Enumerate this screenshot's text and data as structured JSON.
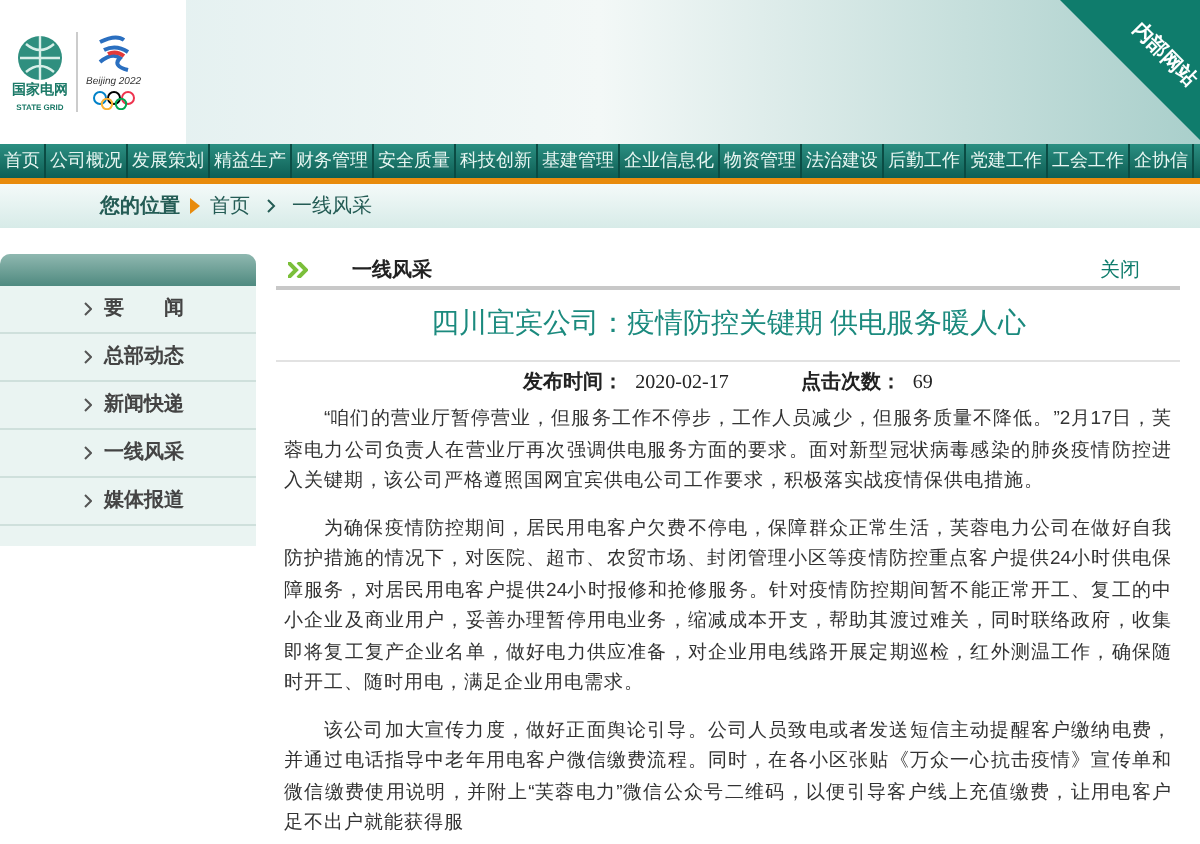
{
  "header": {
    "logo_text": "国家电网",
    "logo_subtext": "STATE GRID",
    "olympic_text": "Beijing 2022",
    "corner_ribbon": "内部网站"
  },
  "nav": [
    {
      "label": "首页"
    },
    {
      "label": "公司概况"
    },
    {
      "label": "发展策划"
    },
    {
      "label": "精益生产"
    },
    {
      "label": "财务管理"
    },
    {
      "label": "安全质量"
    },
    {
      "label": "科技创新"
    },
    {
      "label": "基建管理"
    },
    {
      "label": "企业信息化"
    },
    {
      "label": "物资管理"
    },
    {
      "label": "法治建设"
    },
    {
      "label": "后勤工作"
    },
    {
      "label": "党建工作"
    },
    {
      "label": "工会工作"
    },
    {
      "label": "企协信"
    }
  ],
  "breadcrumb": {
    "label": "您的位置",
    "items": [
      "首页",
      "一线风采"
    ]
  },
  "sidebar": {
    "items": [
      "要　　闻",
      "总部动态",
      "新闻快递",
      "一线风采",
      "媒体报道"
    ]
  },
  "section": {
    "title": "一线风采",
    "close": "关闭"
  },
  "article": {
    "title": "四川宜宾公司：疫情防控关键期 供电服务暖人心",
    "date_label": "发布时间：",
    "date": "2020-02-17",
    "hits_label": "点击次数：",
    "hits": "69",
    "paragraphs": [
      "“咱们的营业厅暂停营业，但服务工作不停步，工作人员减少，但服务质量不降低。”2月17日，芙蓉电力公司负责人在营业厅再次强调供电服务方面的要求。面对新型冠状病毒感染的肺炎疫情防控进入关键期，该公司严格遵照国网宜宾供电公司工作要求，积极落实战疫情保供电措施。",
      "为确保疫情防控期间，居民用电客户欠费不停电，保障群众正常生活，芙蓉电力公司在做好自我防护措施的情况下，对医院、超市、农贸市场、封闭管理小区等疫情防控重点客户提供24小时供电保障服务，对居民用电客户提供24小时报修和抢修服务。针对疫情防控期间暂不能正常开工、复工的中小企业及商业用户，妥善办理暂停用电业务，缩减成本开支，帮助其渡过难关，同时联络政府，收集即将复工复产企业名单，做好电力供应准备，对企业用电线路开展定期巡检，红外测温工作，确保随时开工、随时用电，满足企业用电需求。",
      "该公司加大宣传力度，做好正面舆论引导。公司人员致电或者发送短信主动提醒客户缴纳电费，并通过电话指导中老年用电客户微信缴费流程。同时，在各小区张贴《万众一心抗击疫情》宣传单和微信缴费使用说明，并附上“芙蓉电力”微信公众号二维码，以便引导客户线上充值缴费，让用电客户足不出户就能获得服"
    ]
  }
}
